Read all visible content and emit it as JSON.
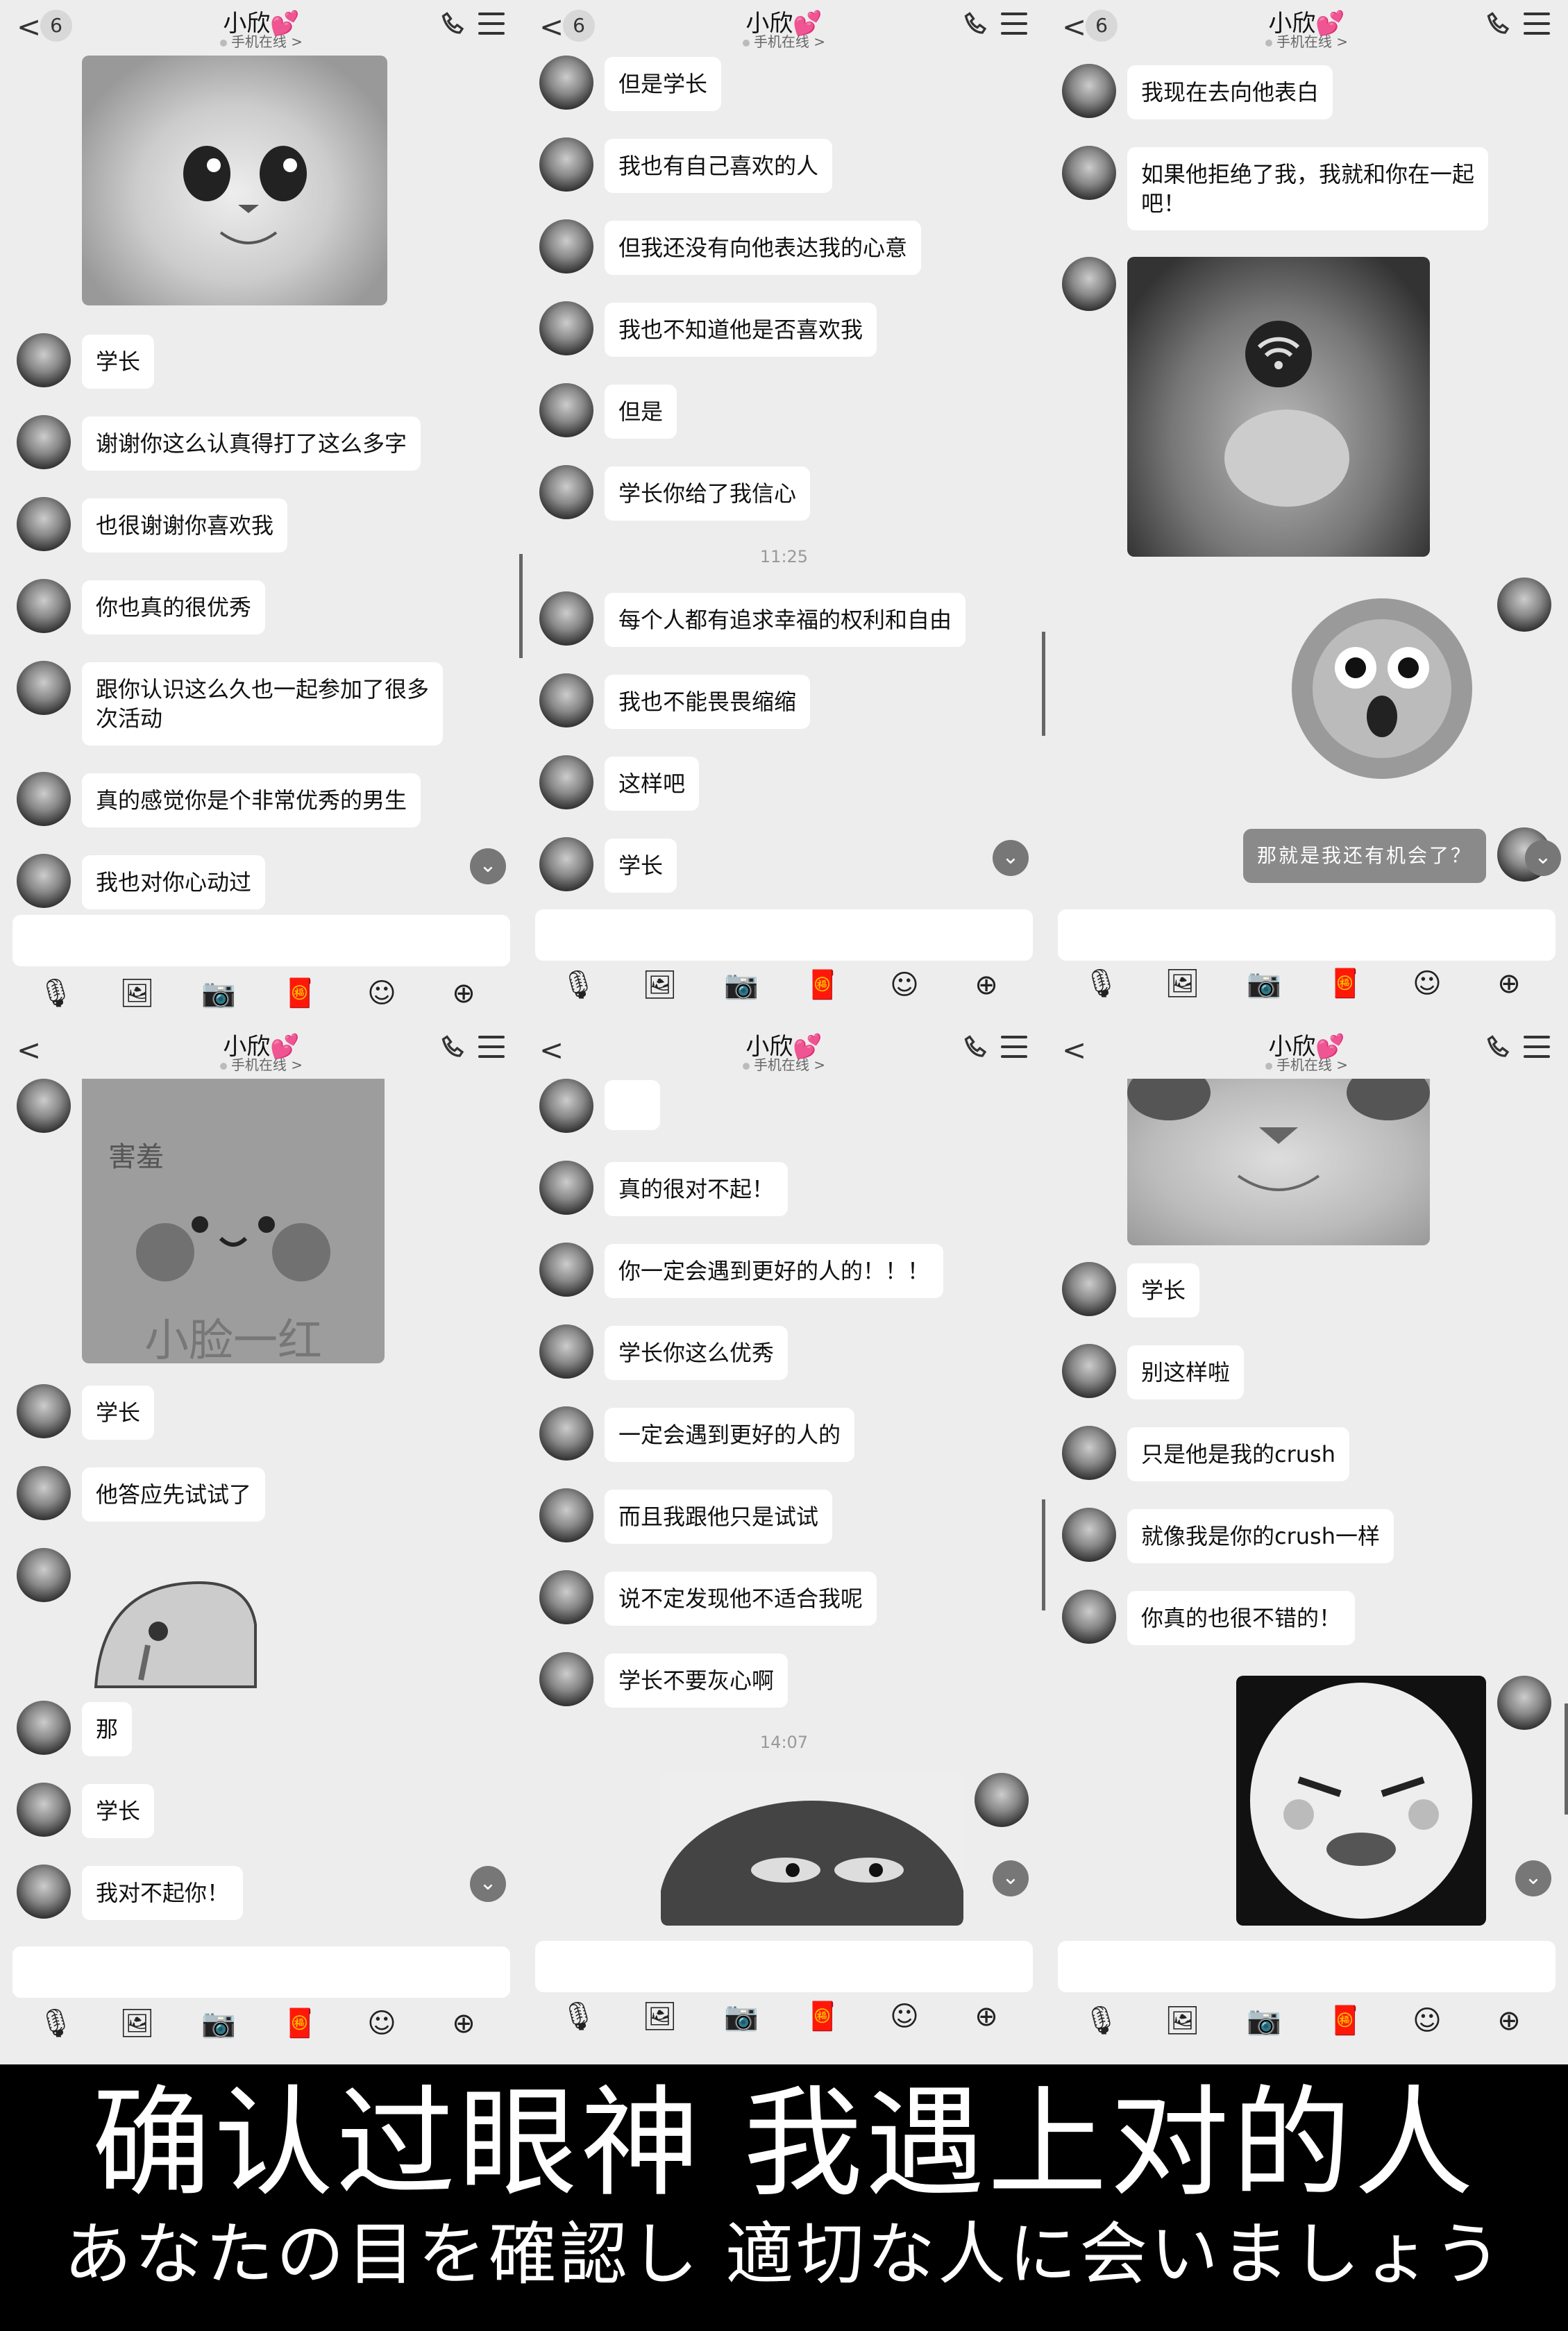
{
  "header": {
    "contact_name": "小欣💕",
    "status": "手机在线 >",
    "unread_badge": "6"
  },
  "panels": [
    {
      "messages": [
        "学长",
        "谢谢你这么认真得打了这么多字",
        "也很谢谢你喜欢我",
        "你也真的很优秀",
        "跟你认识这么久也一起参加了很多\n次活动",
        "真的感觉你是个非常优秀的男生",
        "我也对你心动过"
      ]
    },
    {
      "messages": [
        "但是学长",
        "我也有自己喜欢的人",
        "但我还没有向他表达我的心意",
        "我也不知道他是否喜欢我",
        "但是",
        "学长你给了我信心",
        "每个人都有追求幸福的权利和自由",
        "我也不能畏畏缩缩",
        "这样吧",
        "学长"
      ],
      "timestamp": "11:25"
    },
    {
      "messages": [
        "我现在去向他表白",
        "如果他拒绝了我，我就和你在一起\n吧！"
      ],
      "my_message": "那就是我还有机会了？"
    },
    {
      "messages": [
        "学长",
        "他答应先试试了",
        "那",
        "学长",
        "我对不起你！"
      ],
      "sticker_text": [
        "害羞",
        "小脸一红"
      ]
    },
    {
      "messages": [
        "真的很对不起！",
        "你一定会遇到更好的人的！！！",
        "学长你这么优秀",
        "一定会遇到更好的人的",
        "而且我跟他只是试试",
        "说不定发现他不适合我呢",
        "学长不要灰心啊"
      ],
      "timestamp": "14:07"
    },
    {
      "messages": [
        "学长",
        "别这样啦",
        "只是他是我的crush",
        "就像我是你的crush一样",
        "你真的也很不错的！"
      ]
    }
  ],
  "caption": {
    "chinese": "确认过眼神 我遇上对的人",
    "japanese": "あなたの目を確認し 適切な人に会いましょう"
  },
  "icons": [
    "back-icon",
    "phone-icon",
    "menu-icon",
    "mic-icon",
    "image-icon",
    "camera-icon",
    "red-packet-icon",
    "emoji-icon",
    "plus-icon",
    "scroll-down-icon"
  ]
}
